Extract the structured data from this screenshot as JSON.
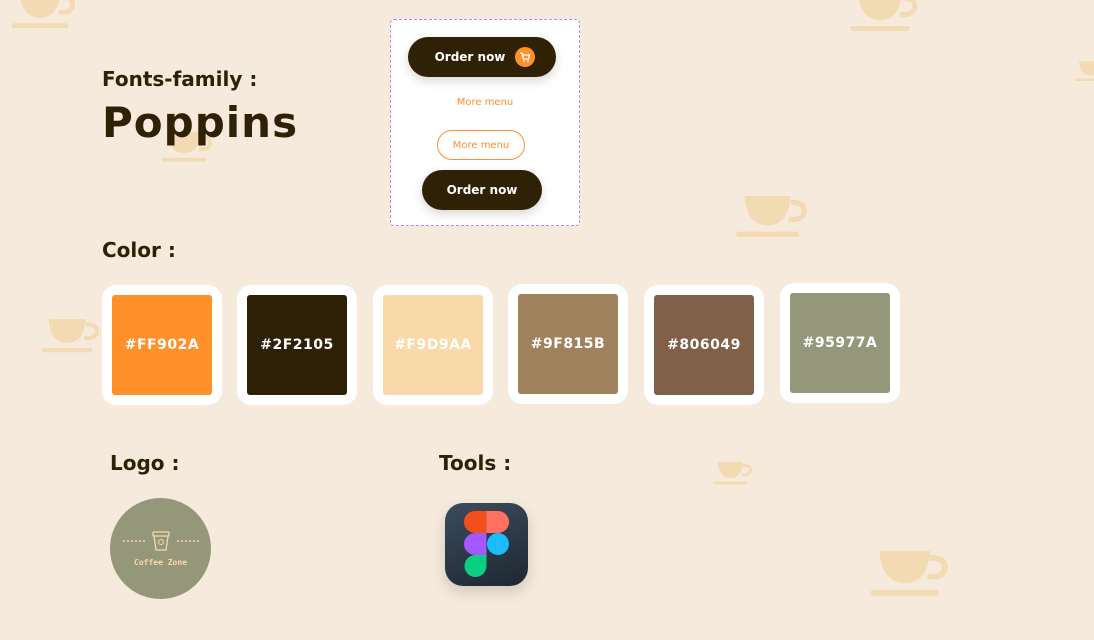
{
  "fonts": {
    "label": "Fonts-family :",
    "name": "Poppins"
  },
  "buttons": {
    "order_now": "Order now",
    "more_menu_link": "More menu",
    "more_menu_outline": "More menu",
    "order_now_2": "Order now"
  },
  "color": {
    "label": "Color :",
    "swatches": [
      {
        "hex": "#FF902A"
      },
      {
        "hex": "#2F2105"
      },
      {
        "hex": "#F9D9AA"
      },
      {
        "hex": "#9F815B"
      },
      {
        "hex": "#806049"
      },
      {
        "hex": "#95977A"
      }
    ]
  },
  "logo": {
    "label": "Logo :",
    "text": "Coffee Zone"
  },
  "tools": {
    "label": "Tools :"
  },
  "icons": {
    "cart": "cart-icon",
    "cup": "coffee-cup-icon",
    "figma": "figma-icon"
  },
  "colors": {
    "background": "#F5EADB",
    "accent": "#FF902A",
    "dark": "#2F2105",
    "dashed_border": "#A98DF0"
  }
}
